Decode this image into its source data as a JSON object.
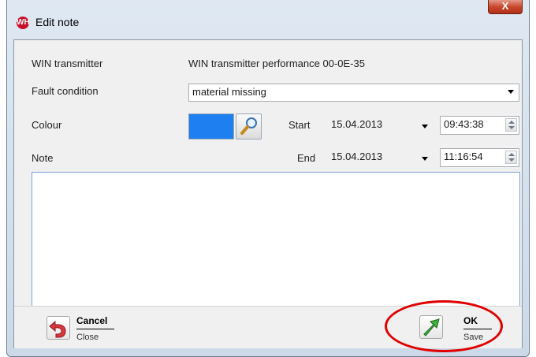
{
  "window": {
    "title": "Edit note",
    "app_icon_glyph": "WH",
    "close_glyph": "X"
  },
  "form": {
    "transmitter_label": "WIN transmitter",
    "transmitter_value": "WIN transmitter performance 00-0E-35",
    "fault_label": "Fault condition",
    "fault_value": "material missing",
    "colour_label": "Colour",
    "colour_value": "#1e7ff0",
    "note_label": "Note",
    "start_label": "Start",
    "start_date": "15.04.2013",
    "start_time": "09:43:38",
    "end_label": "End",
    "end_date": "15.04.2013",
    "end_time": "11:16:54",
    "note_text": ""
  },
  "buttons": {
    "cancel_title": "Cancel",
    "cancel_sub": "Close",
    "ok_title": "OK",
    "ok_sub": "Save"
  },
  "colors": {
    "highlight": "#e10000"
  },
  "icons": {
    "app": "app-logo-icon",
    "close": "close-icon",
    "search": "search-icon",
    "cancel": "undo-arrow-icon",
    "ok": "green-arrow-icon"
  }
}
